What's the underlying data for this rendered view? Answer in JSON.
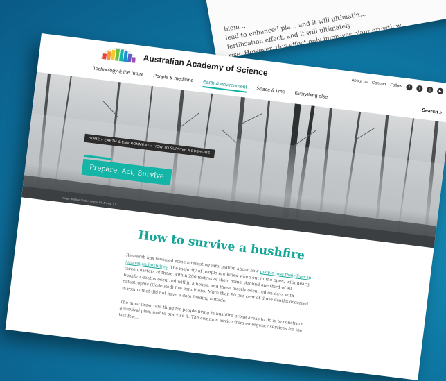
{
  "back_page": {
    "lines": [
      "biom…",
      "lead to enhanced pla… and it will ultimatin…",
      "fertilisation effect, and it will ultimately",
      "rise. However, this effect only improves plant growth w…"
    ]
  },
  "header": {
    "brand": "Australian Academy of Science",
    "utility_links": [
      "About us",
      "Contact",
      "Follow"
    ],
    "search_label": "Search",
    "nav": [
      {
        "label": "Technology & the future",
        "active": false
      },
      {
        "label": "People & medicine",
        "active": false
      },
      {
        "label": "Earth & environment",
        "active": true
      },
      {
        "label": "Space & time",
        "active": false
      },
      {
        "label": "Everything else",
        "active": false
      }
    ]
  },
  "hero": {
    "breadcrumb": "HOME » EARTH & ENVIRONMENT » HOW TO SURVIVE A BUSHFIRE",
    "tag": "Prepare, Act, Survive",
    "credit": "Image: Michael Dalton / Flickr CC BY-NC 2.0"
  },
  "article": {
    "title": "How to survive a bushfire",
    "p1_a": "Research has revealed some interesting information about how ",
    "p1_link": "people lose their lives in Australian bushfires",
    "p1_b": ". The majority of people are killed when out in the open, with nearly three quarters of these within 200 metres of their home. Around one third of all bushfire deaths occurred within a house, and these mostly occurred on days with catastrophic (Code Red) fire conditions. More than 90 per cent of those deaths occurred in rooms that did not have a door leading outside.",
    "p2": "The most important thing for people living in bushfire-prone areas to do is to construct a survival plan, and to practise it. The common advice from emergency services for the last few..."
  },
  "colors": {
    "accent": "#14b5a6",
    "background": "#0f7aa6"
  },
  "icons": [
    "facebook-icon",
    "twitter-icon",
    "instagram-icon",
    "youtube-icon",
    "search-icon"
  ]
}
